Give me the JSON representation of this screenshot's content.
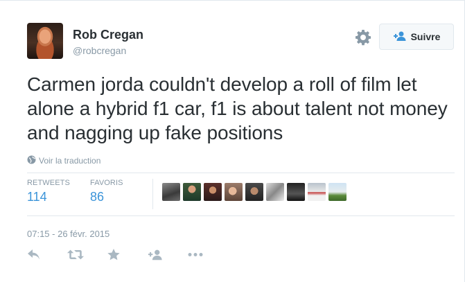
{
  "tweet": {
    "author": {
      "name": "Rob Cregan",
      "handle": "@robcregan"
    },
    "follow_label": "Suivre",
    "text": "Carmen jorda couldn't develop a roll of film let alone a hybrid f1 car, f1 is about talent not money and nagging up fake positions",
    "translate_label": "Voir la traduction",
    "stats": {
      "retweets_label": "RETWEETS",
      "retweets_count": "114",
      "favorites_label": "FAVORIS",
      "favorites_count": "86"
    },
    "timestamp": "07:15 - 26 févr. 2015",
    "favoriter_avatars": 9
  },
  "icons": {
    "settings": "gear-icon",
    "follow": "follow-user-icon",
    "translate": "globe-icon",
    "reply": "reply-icon",
    "retweet": "retweet-icon",
    "favorite": "star-icon",
    "add": "add-user-icon",
    "more": "more-icon"
  },
  "colors": {
    "link": "#3b94d9",
    "muted": "#8899a6",
    "text": "#292f33",
    "border": "#e1e8ed"
  }
}
